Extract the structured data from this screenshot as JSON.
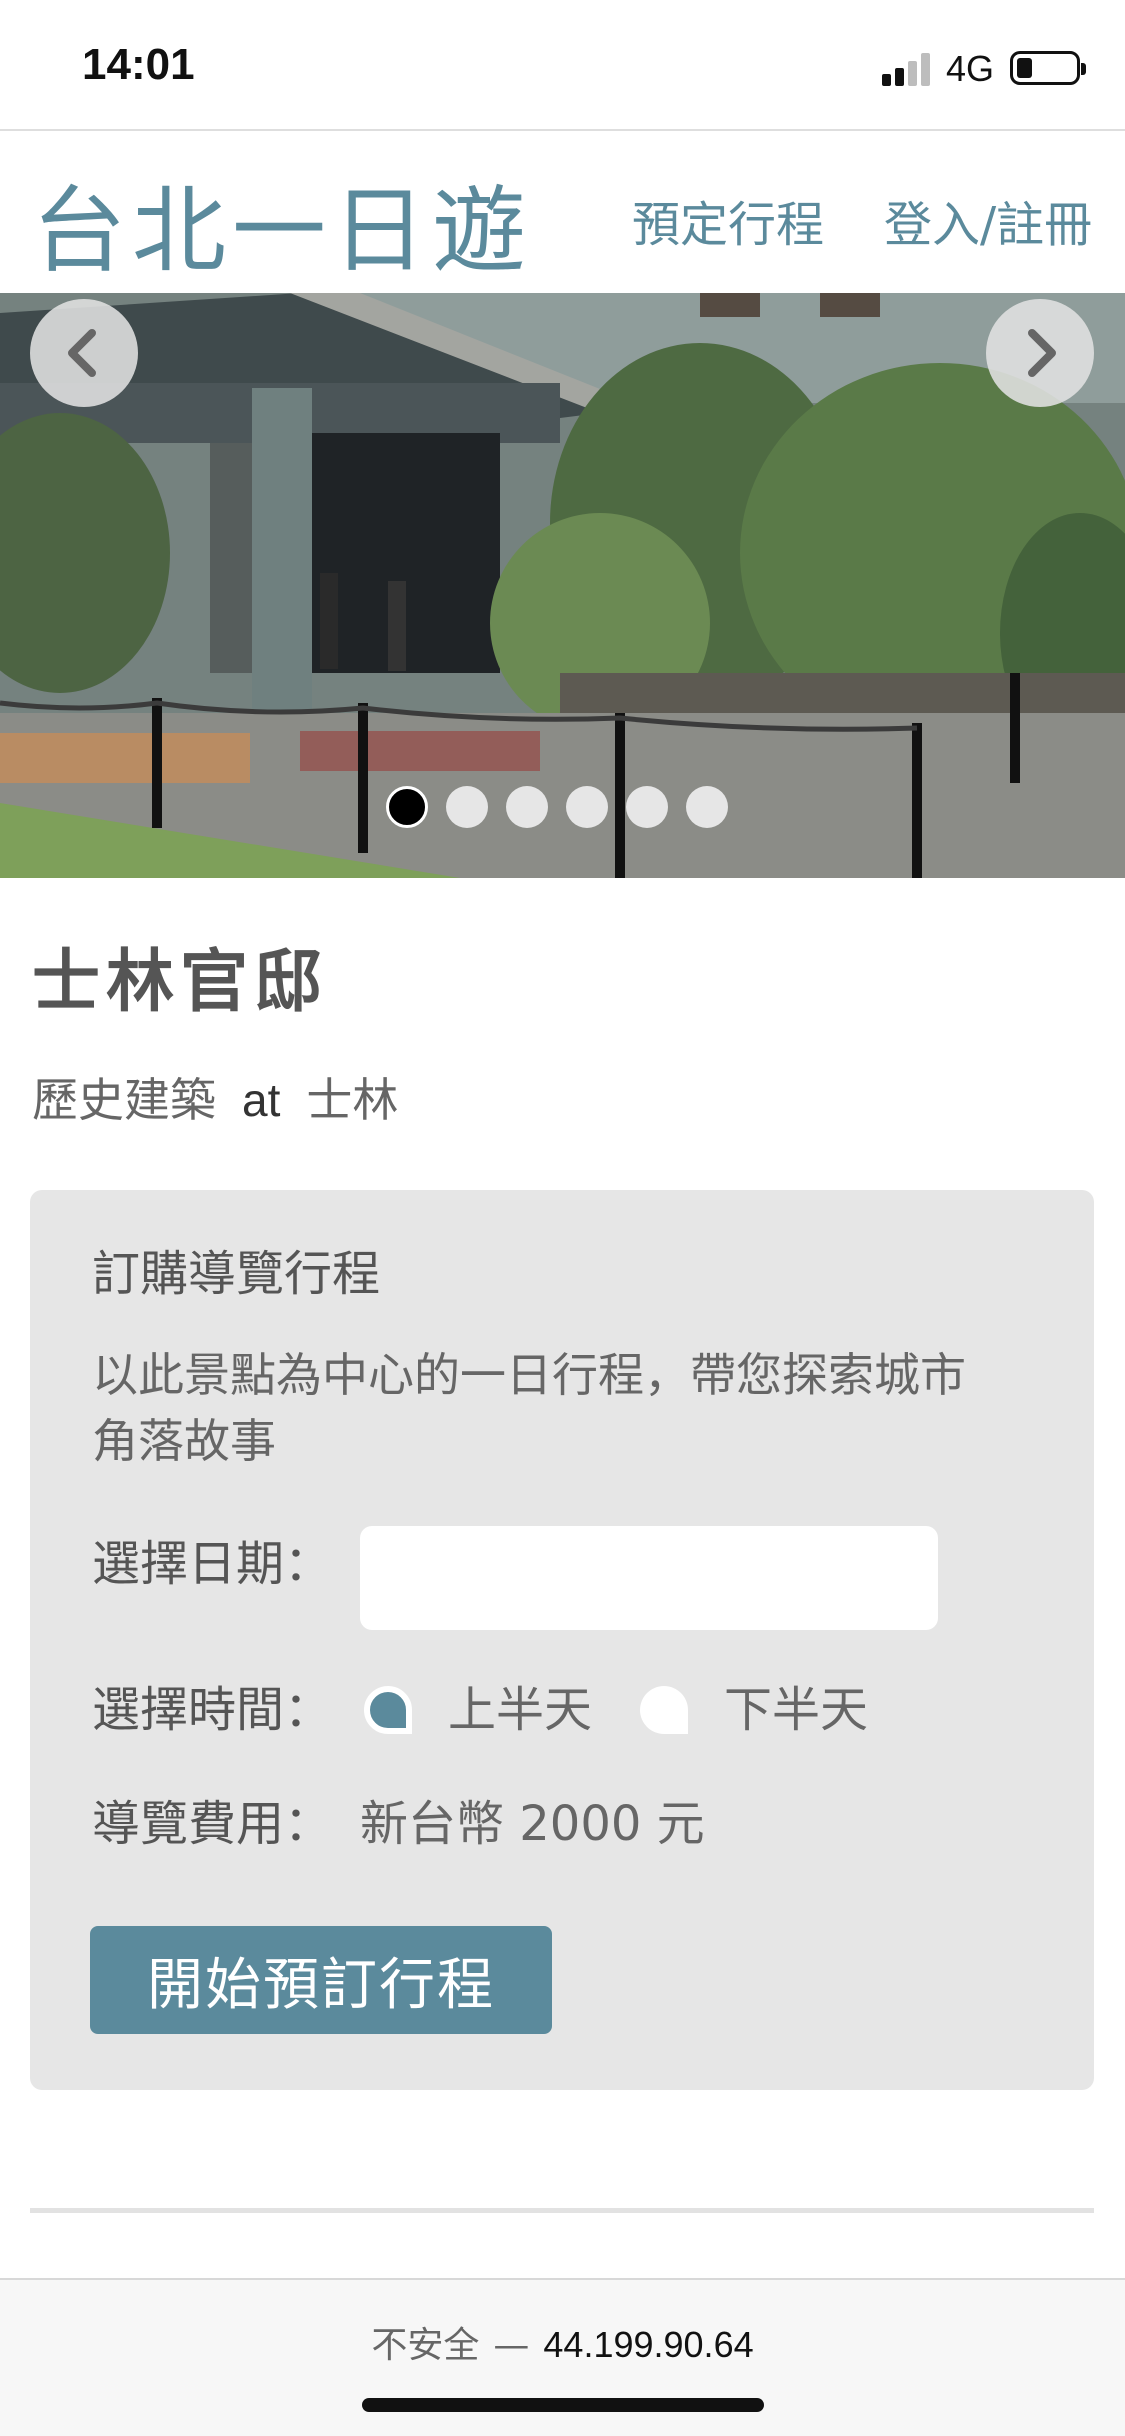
{
  "status_bar": {
    "time": "14:01",
    "network": "4G",
    "icons": [
      "signal-icon",
      "battery-icon"
    ]
  },
  "header": {
    "site_title": "台北一日遊",
    "nav": [
      {
        "label": "預定行程"
      },
      {
        "label": "登入/註冊"
      }
    ]
  },
  "carousel": {
    "prev_icon": "chevron-left-icon",
    "next_icon": "chevron-right-icon",
    "slide_count": 6,
    "active_index": 0
  },
  "attraction": {
    "name": "士林官邸",
    "category": "歷史建築",
    "at": "at",
    "district": "士林"
  },
  "booking": {
    "title": "訂購導覽行程",
    "description": "以此景點為中心的一日行程，帶您探索城市角落故事",
    "date_label": "選擇日期：",
    "date_value": "",
    "time_label": "選擇時間：",
    "time_options": [
      {
        "label": "上半天",
        "selected": true
      },
      {
        "label": "下半天",
        "selected": false
      }
    ],
    "fee_label": "導覽費用：",
    "fee_value": "新台幣 2000 元",
    "submit_label": "開始預訂行程"
  },
  "browser": {
    "security_label": "不安全",
    "separator": "—",
    "host": "44.199.90.64"
  },
  "colors": {
    "accent": "#5b8a9c",
    "panel_bg": "#e6e6e6"
  }
}
